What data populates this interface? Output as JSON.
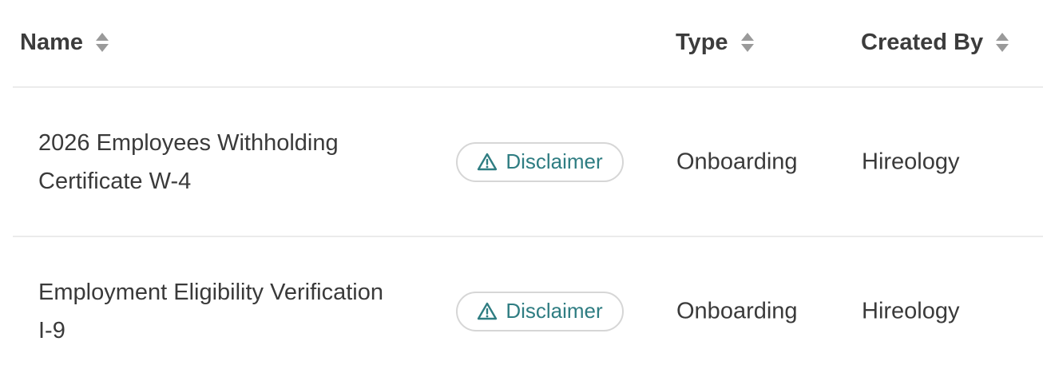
{
  "table": {
    "columns": [
      {
        "label": "Name",
        "sortable": true
      },
      {
        "label": "Type",
        "sortable": true
      },
      {
        "label": "Created By",
        "sortable": true
      }
    ],
    "rows": [
      {
        "name": "2026 Employees Withholding Certificate W-4",
        "badge": "Disclaimer",
        "type": "Onboarding",
        "created_by": "Hireology"
      },
      {
        "name": "Employment Eligibility Verification I-9",
        "badge": "Disclaimer",
        "type": "Onboarding",
        "created_by": "Hireology"
      }
    ]
  },
  "icons": {
    "sort": "sort-icon",
    "badge": "warning-icon"
  },
  "colors": {
    "badge_text": "#2f7d82",
    "badge_border": "#d6d6d6",
    "divider": "#ebebeb",
    "sort_icon": "#9a9a9a"
  }
}
